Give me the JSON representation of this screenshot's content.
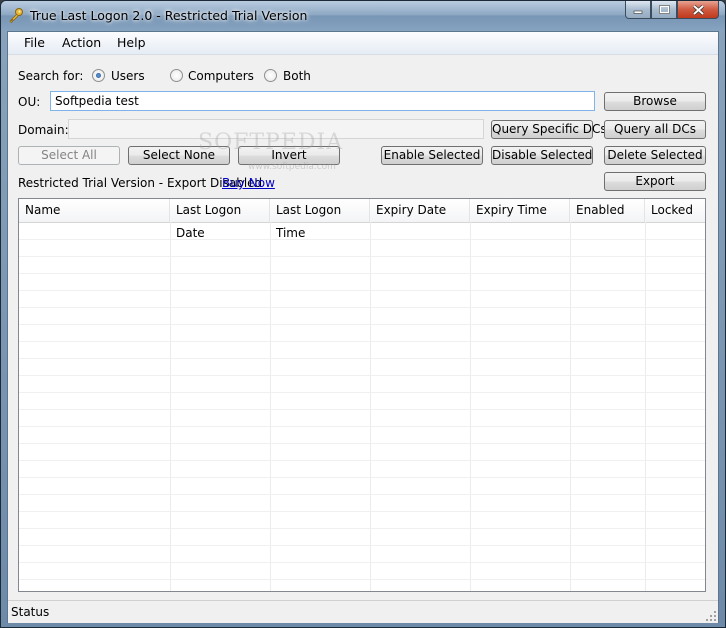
{
  "window": {
    "title": "True Last Logon 2.0 - Restricted Trial Version"
  },
  "menu": [
    "File",
    "Action",
    "Help"
  ],
  "search": {
    "label": "Search for:",
    "options": [
      {
        "label": "Users",
        "checked": true
      },
      {
        "label": "Computers",
        "checked": false
      },
      {
        "label": "Both",
        "checked": false
      }
    ]
  },
  "ou": {
    "label": "OU:",
    "value": "Softpedia test",
    "browse_label": "Browse"
  },
  "domain": {
    "label": "Domain:",
    "value": "",
    "query_specific_label": "Query Specific DCs",
    "query_all_label": "Query all DCs"
  },
  "buttons": {
    "select_all": "Select All",
    "select_none": "Select None",
    "invert": "Invert",
    "enable_selected": "Enable Selected",
    "disable_selected": "Disable Selected",
    "delete_selected": "Delete Selected",
    "export": "Export"
  },
  "trial": {
    "text": "Restricted Trial Version - Export Disabled",
    "buy_now": "Buy Now"
  },
  "grid": {
    "columns": [
      "Name",
      "Last Logon Date",
      "Last Logon Time",
      "Expiry Date",
      "Expiry Time",
      "Enabled",
      "Locked"
    ],
    "rows": []
  },
  "watermark": {
    "text": "SOFTPEDIA",
    "sub": "www.softpedia.com"
  },
  "status": {
    "text": "Status"
  },
  "colors": {
    "link": "#0000cc",
    "titlebar": "#8fa9c4",
    "close": "#c0391d"
  },
  "icons": [
    "key-icon",
    "minimize-icon",
    "maximize-icon",
    "close-icon",
    "size-grip-icon"
  ]
}
